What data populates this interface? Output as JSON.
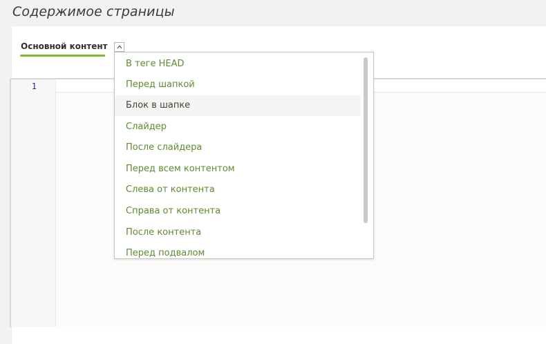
{
  "page": {
    "title": "Содержимое страницы"
  },
  "tabs": {
    "main_label": "Основной контент"
  },
  "editor": {
    "line_numbers": [
      "1"
    ]
  },
  "dropdown": {
    "items": [
      {
        "label": "В теге HEAD"
      },
      {
        "label": "Перед шапкой"
      },
      {
        "label": "Блок в шапке",
        "highlighted": true
      },
      {
        "label": "Слайдер"
      },
      {
        "label": "После слайдера"
      },
      {
        "label": "Перед всем контентом"
      },
      {
        "label": "Слева от контента"
      },
      {
        "label": "Справа от контента"
      },
      {
        "label": "После контента"
      },
      {
        "label": "Перед подвалом"
      }
    ]
  },
  "colors": {
    "accent": "#7cba2f",
    "menu_text": "#5f8a2f",
    "line_number": "#2b2b8f"
  },
  "icons": {
    "toggle": "chevron-up-icon"
  }
}
